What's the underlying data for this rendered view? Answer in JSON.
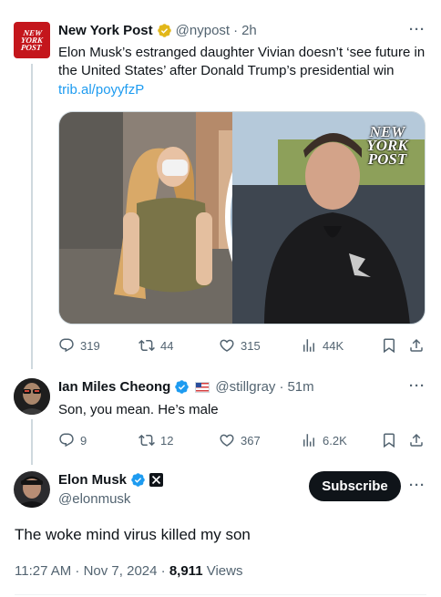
{
  "colors": {
    "accent": "#1d9bf0",
    "text": "#0f1419",
    "muted": "#536471",
    "nyp_red": "#c4161c",
    "gold_badge": "#e2b719"
  },
  "tweet1": {
    "avatar_text": "NEW YORK POST",
    "name": "New York Post",
    "handle": "@nypost",
    "sep": "·",
    "time": "2h",
    "more": "···",
    "text": "Elon Musk’s estranged daughter Vivian doesn’t ‘see future in the United States’ after Donald Trump’s presidential win",
    "link": "trib.al/poyyfzP",
    "media_watermark": "NEW YORK POST",
    "actions": {
      "replies": "319",
      "reposts": "44",
      "likes": "315",
      "views": "44K"
    }
  },
  "tweet2": {
    "name": "Ian Miles Cheong",
    "handle": "@stillgray",
    "sep": "·",
    "time": "51m",
    "more": "···",
    "text": "Son, you mean. He’s male",
    "actions": {
      "replies": "9",
      "reposts": "12",
      "likes": "367",
      "views": "6.2K"
    }
  },
  "main_tweet": {
    "name": "Elon Musk",
    "handle": "@elonmusk",
    "subscribe_label": "Subscribe",
    "more": "···",
    "text": "The woke mind virus killed my son",
    "time": "11:27 AM · Nov 7, 2024 ·",
    "views_count": "8,911",
    "views_label": "Views"
  },
  "icons": [
    "verified-gold-icon",
    "verified-blue-icon",
    "x-affiliate-icon",
    "flag-icon",
    "reply-icon",
    "repost-icon",
    "like-icon",
    "views-icon",
    "bookmark-icon",
    "share-icon",
    "more-icon"
  ]
}
